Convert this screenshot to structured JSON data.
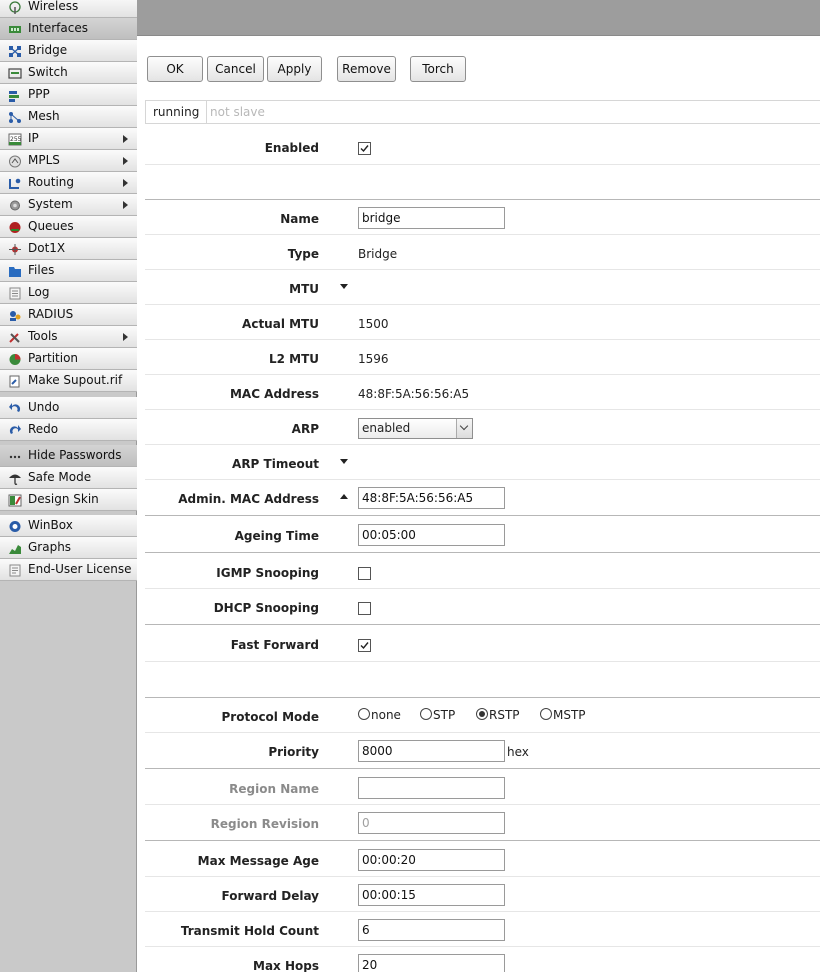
{
  "sidebar": {
    "items": [
      {
        "label": "Wireless",
        "icon": "wireless-icon",
        "active": false,
        "submenu": false
      },
      {
        "label": "Interfaces",
        "icon": "interfaces-icon",
        "active": true,
        "submenu": false
      },
      {
        "label": "Bridge",
        "icon": "bridge-icon",
        "active": false,
        "submenu": false
      },
      {
        "label": "Switch",
        "icon": "switch-icon",
        "active": false,
        "submenu": false
      },
      {
        "label": "PPP",
        "icon": "ppp-icon",
        "active": false,
        "submenu": false
      },
      {
        "label": "Mesh",
        "icon": "mesh-icon",
        "active": false,
        "submenu": false
      },
      {
        "label": "IP",
        "icon": "ip-icon",
        "active": false,
        "submenu": true
      },
      {
        "label": "MPLS",
        "icon": "mpls-icon",
        "active": false,
        "submenu": true
      },
      {
        "label": "Routing",
        "icon": "routing-icon",
        "active": false,
        "submenu": true
      },
      {
        "label": "System",
        "icon": "system-icon",
        "active": false,
        "submenu": true
      },
      {
        "label": "Queues",
        "icon": "queues-icon",
        "active": false,
        "submenu": false
      },
      {
        "label": "Dot1X",
        "icon": "dot1x-icon",
        "active": false,
        "submenu": false
      },
      {
        "label": "Files",
        "icon": "files-icon",
        "active": false,
        "submenu": false
      },
      {
        "label": "Log",
        "icon": "log-icon",
        "active": false,
        "submenu": false
      },
      {
        "label": "RADIUS",
        "icon": "radius-icon",
        "active": false,
        "submenu": false
      },
      {
        "label": "Tools",
        "icon": "tools-icon",
        "active": false,
        "submenu": true
      },
      {
        "label": "Partition",
        "icon": "partition-icon",
        "active": false,
        "submenu": false
      },
      {
        "label": "Make Supout.rif",
        "icon": "supout-icon",
        "active": false,
        "submenu": false
      }
    ],
    "items2": [
      {
        "label": "Undo",
        "icon": "undo-icon"
      },
      {
        "label": "Redo",
        "icon": "redo-icon"
      }
    ],
    "items3": [
      {
        "label": "Hide Passwords",
        "icon": "hide-passwords-icon",
        "active": true
      },
      {
        "label": "Safe Mode",
        "icon": "safe-mode-icon",
        "active": false
      },
      {
        "label": "Design Skin",
        "icon": "design-skin-icon",
        "active": false
      }
    ],
    "items4": [
      {
        "label": "WinBox",
        "icon": "winbox-icon"
      },
      {
        "label": "Graphs",
        "icon": "graphs-icon"
      },
      {
        "label": "End-User License",
        "icon": "license-icon"
      }
    ]
  },
  "toolbar": {
    "ok": "OK",
    "cancel": "Cancel",
    "apply": "Apply",
    "remove": "Remove",
    "torch": "Torch"
  },
  "status": {
    "running": "running",
    "slave": "not slave"
  },
  "form": {
    "enabled": {
      "label": "Enabled",
      "checked": true
    },
    "name": {
      "label": "Name",
      "value": "bridge"
    },
    "type": {
      "label": "Type",
      "value": "Bridge"
    },
    "mtu": {
      "label": "MTU"
    },
    "actual_mtu": {
      "label": "Actual MTU",
      "value": "1500"
    },
    "l2_mtu": {
      "label": "L2 MTU",
      "value": "1596"
    },
    "mac": {
      "label": "MAC Address",
      "value": "48:8F:5A:56:56:A5"
    },
    "arp": {
      "label": "ARP",
      "value": "enabled"
    },
    "arp_timeout": {
      "label": "ARP Timeout"
    },
    "admin_mac": {
      "label": "Admin. MAC Address",
      "value": "48:8F:5A:56:56:A5"
    },
    "ageing_time": {
      "label": "Ageing Time",
      "value": "00:05:00"
    },
    "igmp": {
      "label": "IGMP Snooping",
      "checked": false
    },
    "dhcp": {
      "label": "DHCP Snooping",
      "checked": false
    },
    "fast_forward": {
      "label": "Fast Forward",
      "checked": true
    },
    "protocol_mode": {
      "label": "Protocol Mode",
      "options": [
        "none",
        "STP",
        "RSTP",
        "MSTP"
      ],
      "selected": "RSTP"
    },
    "priority": {
      "label": "Priority",
      "value": "8000",
      "suffix": "hex"
    },
    "region_name": {
      "label": "Region Name",
      "value": ""
    },
    "region_revision": {
      "label": "Region Revision",
      "value": "0"
    },
    "max_message_age": {
      "label": "Max Message Age",
      "value": "00:00:20"
    },
    "forward_delay": {
      "label": "Forward Delay",
      "value": "00:00:15"
    },
    "transmit_hold_count": {
      "label": "Transmit Hold Count",
      "value": "6"
    },
    "max_hops": {
      "label": "Max Hops",
      "value": "20"
    }
  }
}
